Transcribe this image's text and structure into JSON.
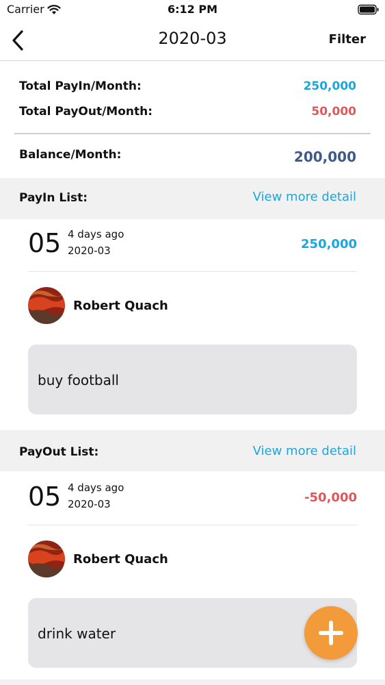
{
  "status_bar": {
    "carrier": "Carrier",
    "time": "6:12 PM"
  },
  "nav": {
    "title": "2020-03",
    "filter_label": "Filter"
  },
  "summary": {
    "payin_label": "Total PayIn/Month:",
    "payin_value": "250,000",
    "payout_label": "Total PayOut/Month:",
    "payout_value": "50,000",
    "balance_label": "Balance/Month:",
    "balance_value": "200,000"
  },
  "payin_section": {
    "title": "PayIn List:",
    "link": "View more detail",
    "item": {
      "day": "05",
      "relative": "4 days ago",
      "date": "2020-03",
      "amount": "250,000",
      "user": "Robert Quach",
      "note": "buy football"
    }
  },
  "payout_section": {
    "title": "PayOut List:",
    "link": "View more detail",
    "item": {
      "day": "05",
      "relative": "4 days ago",
      "date": "2020-03",
      "amount": "-50,000",
      "user": "Robert Quach",
      "note": "drink water"
    }
  },
  "colors": {
    "payin": "#1aa6df",
    "payout": "#e0575b",
    "balance": "#3d5a8a",
    "fab": "#f39a3b"
  },
  "icons": [
    "wifi-icon",
    "battery-icon",
    "back-chevron-icon",
    "avatar-image",
    "plus-icon"
  ]
}
